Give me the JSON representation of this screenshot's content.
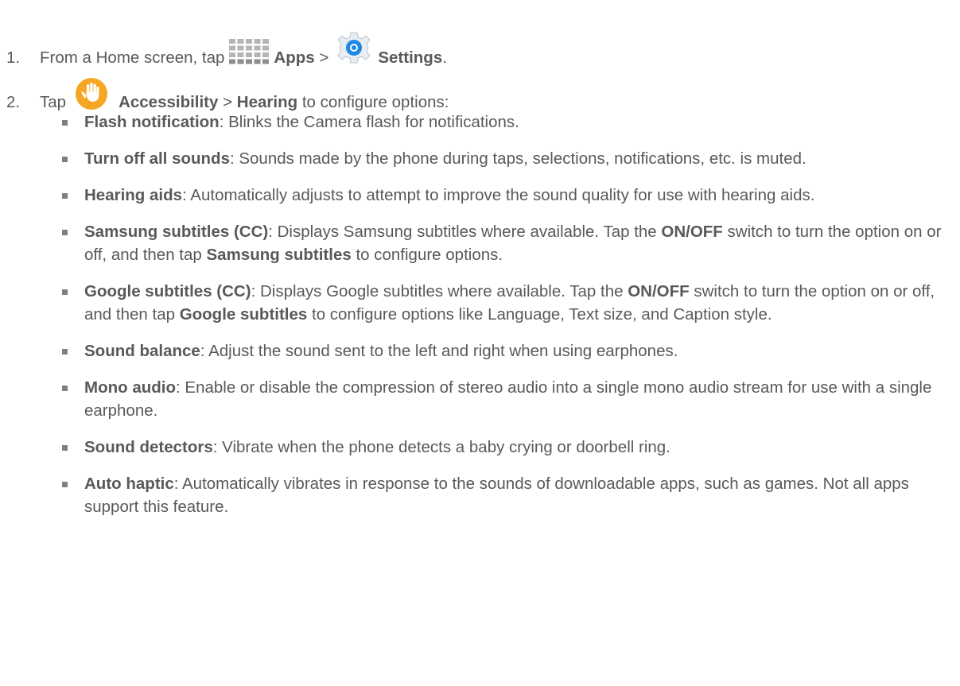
{
  "step1": {
    "number": "1.",
    "text_before": "From a Home screen, tap",
    "apps_label": "Apps",
    "separator": ">",
    "settings_label": "Settings",
    "end": "."
  },
  "step2": {
    "number": "2.",
    "text_before": "Tap",
    "accessibility_label": "Accessibility",
    "separator": ">",
    "hearing_label": "Hearing",
    "text_after": "to configure options:"
  },
  "options": [
    {
      "title": "Flash notification",
      "description": ": Blinks the Camera flash for notifications."
    },
    {
      "title": "Turn off all sounds",
      "description": ": Sounds made by the phone during taps, selections, notifications, etc. is muted."
    },
    {
      "title": "Hearing aids",
      "description": ": Automatically adjusts to attempt to improve the sound quality for use with hearing aids."
    },
    {
      "title": "Samsung subtitles (CC)",
      "description": ": Displays Samsung subtitles where available. Tap the ",
      "bold2": "ON/OFF",
      "mid": " switch to turn the option on or off, and then tap ",
      "bold3": "Samsung subtitles",
      "tail": " to configure options."
    },
    {
      "title": "Google subtitles (CC)",
      "description": ": Displays Google subtitles where available. Tap the ",
      "bold2": "ON/OFF",
      "mid": " switch to turn the option on or off, and then tap ",
      "bold3": "Google subtitles",
      "tail": " to configure options like Language, Text size, and Caption style."
    },
    {
      "title": "Sound balance",
      "description": ": Adjust the sound sent to the left and right when using earphones."
    },
    {
      "title": "Mono audio",
      "description": ": Enable or disable the compression of stereo audio into a single mono audio stream for use with a single earphone."
    },
    {
      "title": "Sound detectors",
      "description": ": Vibrate when the phone detects a baby crying or doorbell ring."
    },
    {
      "title": "Auto haptic",
      "description": ": Automatically vibrates in response to the sounds of downloadable apps, such as games. Not all apps support this feature."
    }
  ],
  "colors": {
    "text": "#595959",
    "bullet": "#7f7f7f",
    "accessibility_icon": "#f5a623",
    "settings_icon": "#1e88e5"
  },
  "icons": [
    "apps-grid-icon",
    "settings-gear-icon",
    "accessibility-hand-icon"
  ]
}
